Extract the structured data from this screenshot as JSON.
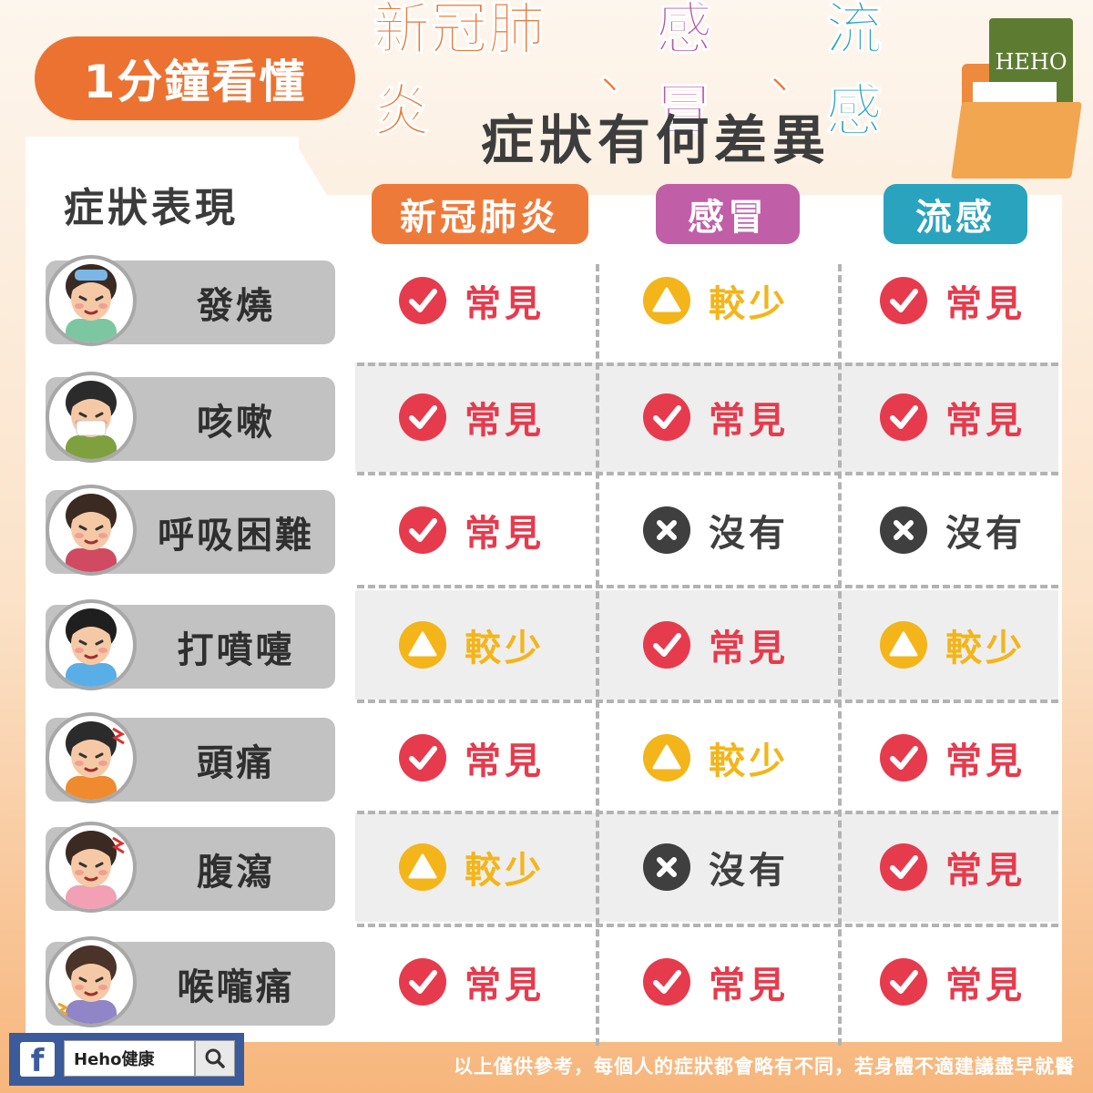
{
  "header": {
    "badge": "1分鐘看懂",
    "title_covid": "新冠肺炎",
    "title_sep1": "、",
    "title_cold": "感冒",
    "title_sep2": "、",
    "title_flu": "流感",
    "subtitle": "症狀有何差異"
  },
  "logo": {
    "text": "HEHO",
    "icon": "folder-icon"
  },
  "table": {
    "symptom_header": "症狀表現",
    "columns": [
      "新冠肺炎",
      "感冒",
      "流感"
    ],
    "column_colors": [
      "#ee7a3a",
      "#c05ea8",
      "#2aa3be"
    ],
    "rows": [
      {
        "symptom": "發燒",
        "avatar": "fever-avatar-icon",
        "values": [
          {
            "type": "check",
            "label": "常見"
          },
          {
            "type": "tri",
            "label": "較少"
          },
          {
            "type": "check",
            "label": "常見"
          }
        ]
      },
      {
        "symptom": "咳嗽",
        "avatar": "cough-avatar-icon",
        "values": [
          {
            "type": "check",
            "label": "常見"
          },
          {
            "type": "check",
            "label": "常見"
          },
          {
            "type": "check",
            "label": "常見"
          }
        ]
      },
      {
        "symptom": "呼吸困難",
        "avatar": "breathing-avatar-icon",
        "values": [
          {
            "type": "check",
            "label": "常見"
          },
          {
            "type": "x",
            "label": "沒有"
          },
          {
            "type": "x",
            "label": "沒有"
          }
        ]
      },
      {
        "symptom": "打噴嚏",
        "avatar": "sneeze-avatar-icon",
        "values": [
          {
            "type": "tri",
            "label": "較少"
          },
          {
            "type": "check",
            "label": "常見"
          },
          {
            "type": "tri",
            "label": "較少"
          }
        ]
      },
      {
        "symptom": "頭痛",
        "avatar": "headache-avatar-icon",
        "values": [
          {
            "type": "check",
            "label": "常見"
          },
          {
            "type": "tri",
            "label": "較少"
          },
          {
            "type": "check",
            "label": "常見"
          }
        ]
      },
      {
        "symptom": "腹瀉",
        "avatar": "diarrhea-avatar-icon",
        "values": [
          {
            "type": "tri",
            "label": "較少"
          },
          {
            "type": "x",
            "label": "沒有"
          },
          {
            "type": "check",
            "label": "常見"
          }
        ]
      },
      {
        "symptom": "喉嚨痛",
        "avatar": "sore-throat-avatar-icon",
        "values": [
          {
            "type": "check",
            "label": "常見"
          },
          {
            "type": "check",
            "label": "常見"
          },
          {
            "type": "check",
            "label": "常見"
          }
        ]
      }
    ],
    "status_colors": {
      "check": "#e63b4d",
      "tri": "#f3b51a",
      "x": "#3f3f3f"
    }
  },
  "footer": {
    "fb_icon": "facebook-icon",
    "search_text": "Heho健康",
    "search_icon": "search-icon",
    "disclaimer": "以上僅供參考，每個人的症狀都會略有不同，若身體不適建議盡早就醫"
  }
}
